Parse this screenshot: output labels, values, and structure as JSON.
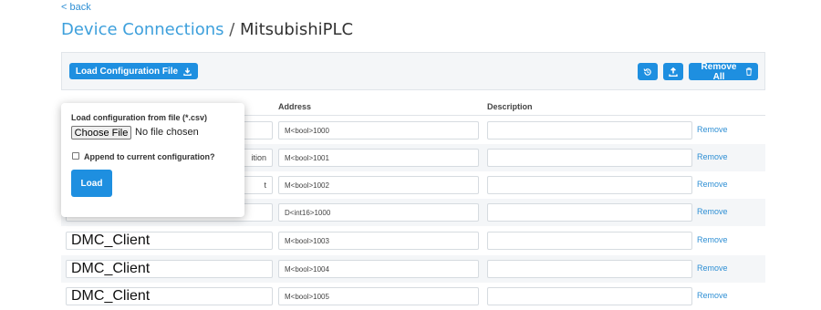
{
  "nav": {
    "back_label": "< back"
  },
  "header": {
    "breadcrumb": "Device Connections",
    "separator": " / ",
    "title": "MitsubishiPLC"
  },
  "toolbar": {
    "load_config_label": "Load Configuration File",
    "remove_all_label": "Remove All"
  },
  "table": {
    "columns": {
      "address": "Address",
      "description": "Description"
    },
    "rows": [
      {
        "name": "",
        "address": "M<bool>1000",
        "description": "",
        "action": "Remove"
      },
      {
        "name": "ition",
        "address": "M<bool>1001",
        "description": "",
        "action": "Remove"
      },
      {
        "name": "t",
        "address": "M<bool>1002",
        "description": "",
        "action": "Remove"
      },
      {
        "name": "",
        "address": "D<int16>1000",
        "description": "",
        "action": "Remove"
      },
      {
        "name": "DMC_Client",
        "address": "M<bool>1003",
        "description": "",
        "action": "Remove"
      },
      {
        "name": "DMC_Client",
        "address": "M<bool>1004",
        "description": "",
        "action": "Remove"
      },
      {
        "name": "DMC_Client",
        "address": "M<bool>1005",
        "description": "",
        "action": "Remove"
      }
    ]
  },
  "popover": {
    "file_label": "Load configuration from file (*.csv)",
    "choose_file_label": "Choose File",
    "file_status": "No file chosen",
    "append_label": "Append to current configuration?",
    "append_checked": false,
    "load_label": "Load"
  },
  "colors": {
    "accent": "#1e8fe0",
    "link": "#2e8fd4",
    "row_shade": "#f4f6f8"
  }
}
